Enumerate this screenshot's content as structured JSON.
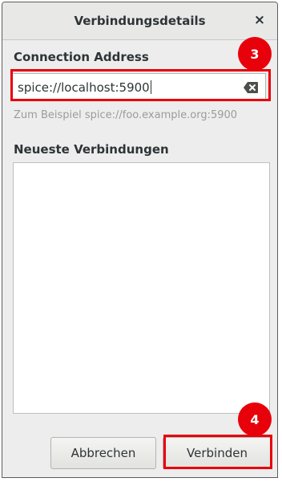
{
  "dialog": {
    "title": "Verbindungsdetails",
    "close_glyph": "×"
  },
  "connection": {
    "heading": "Connection Address",
    "address_value": "spice://localhost:5900",
    "clear_icon": "backspace-clear-icon",
    "hint": "Zum Beispiel spice://foo.example.org:5900"
  },
  "recent": {
    "heading": "Neueste Verbindungen",
    "items": []
  },
  "buttons": {
    "cancel_label": "Abbrechen",
    "connect_label": "Verbinden"
  },
  "annotations": {
    "step_3": "3",
    "step_4": "4",
    "highlight_color": "#e8000b"
  }
}
